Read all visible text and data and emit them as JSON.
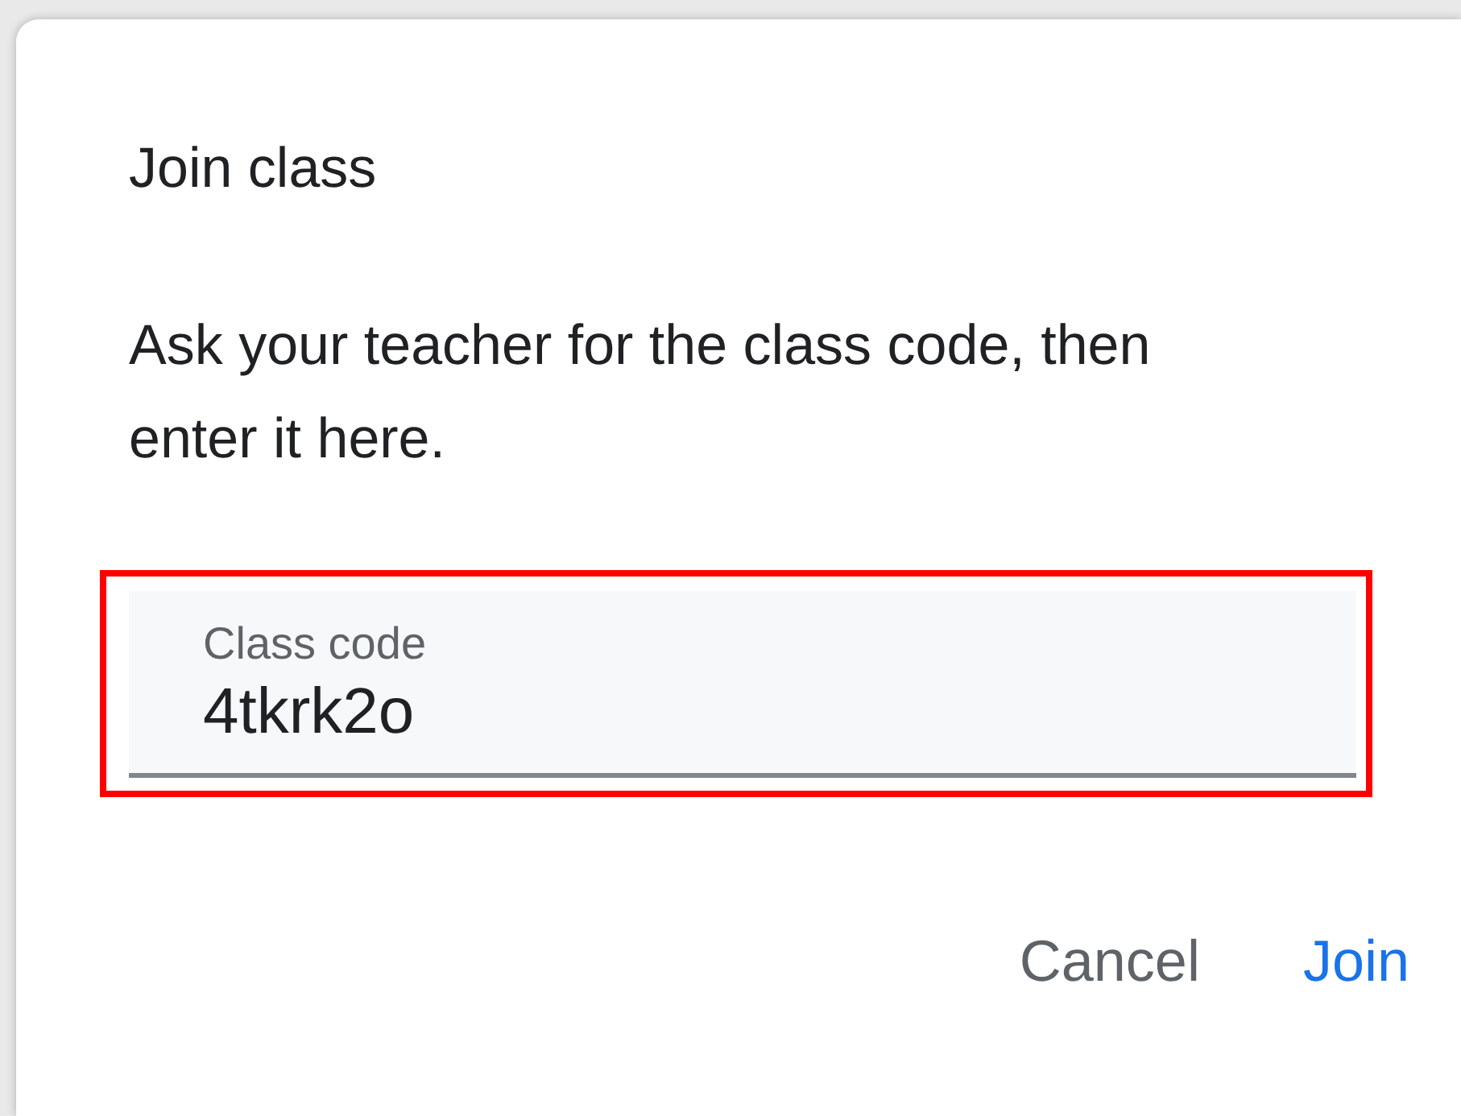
{
  "dialog": {
    "title": "Join class",
    "message": "Ask your teacher for the class code, then enter it here.",
    "field": {
      "label": "Class code",
      "value": "4tkrk2o",
      "highlighted": true
    },
    "buttons": [
      {
        "label": "Cancel",
        "kind": "secondary"
      },
      {
        "label": "Join",
        "kind": "primary"
      }
    ]
  }
}
